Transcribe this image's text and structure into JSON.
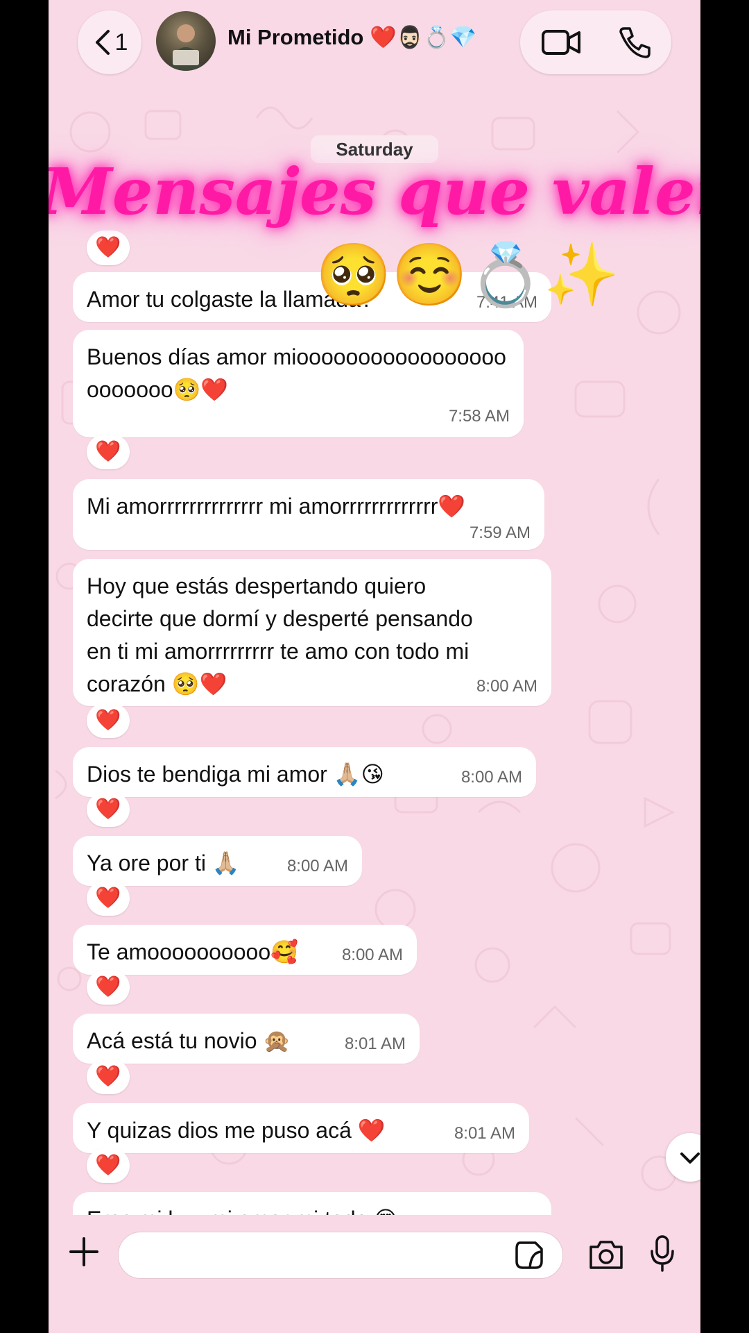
{
  "header": {
    "back_count": "1",
    "contact_name": "Mi Prometido ❤️🧔🏻‍♂️💍💎",
    "icons": [
      "chevron-left-icon",
      "video-icon",
      "phone-icon"
    ]
  },
  "chat": {
    "day_label": "Saturday",
    "messages": [
      {
        "text": "Amor tu colgaste la llamada?",
        "time": "7:41 AM"
      },
      {
        "text": "Buenos días amor mioooooooooooooooooooooooo🥺❤️",
        "time": "7:58 AM",
        "reaction": "❤️"
      },
      {
        "text": "Mi amorrrrrrrrrrrrrr mi amorrrrrrrrrrrrr❤️",
        "time": "7:59 AM"
      },
      {
        "text": "Hoy que estás despertando quiero decirte que dormí y desperté pensando en ti mi amorrrrrrrrr te amo con todo mi corazón 🥺❤️",
        "time": "8:00 AM",
        "reaction": "❤️"
      },
      {
        "text": "Dios te bendiga mi amor 🙏🏼😘",
        "time": "8:00 AM",
        "reaction": "❤️"
      },
      {
        "text": "Ya ore por ti 🙏🏼",
        "time": "8:00 AM",
        "reaction": "❤️"
      },
      {
        "text": "Te amoooooooooo🥰",
        "time": "8:00 AM",
        "reaction": "❤️"
      },
      {
        "text": "Acá está tu novio 🙊",
        "time": "8:01 AM",
        "reaction": "❤️"
      },
      {
        "text": "Y quizas dios me puso acá ❤️",
        "time": "8:01 AM",
        "reaction": "❤️"
      },
      {
        "text": "Eres mi luz, mi amor mi todo 😍",
        "time": ""
      }
    ],
    "first_reaction": "❤️"
  },
  "overlay": {
    "title": "Mensajes que valen oro",
    "emojis": "🥺☺️💍✨"
  },
  "composer": {
    "placeholder": "",
    "icons": [
      "plus-icon",
      "sticker-icon",
      "camera-icon",
      "microphone-icon"
    ]
  },
  "colors": {
    "background": "#f9d9e6",
    "bubble": "#ffffff",
    "overlay_text": "#ff1aa5",
    "reaction_heart": "#e81928"
  }
}
